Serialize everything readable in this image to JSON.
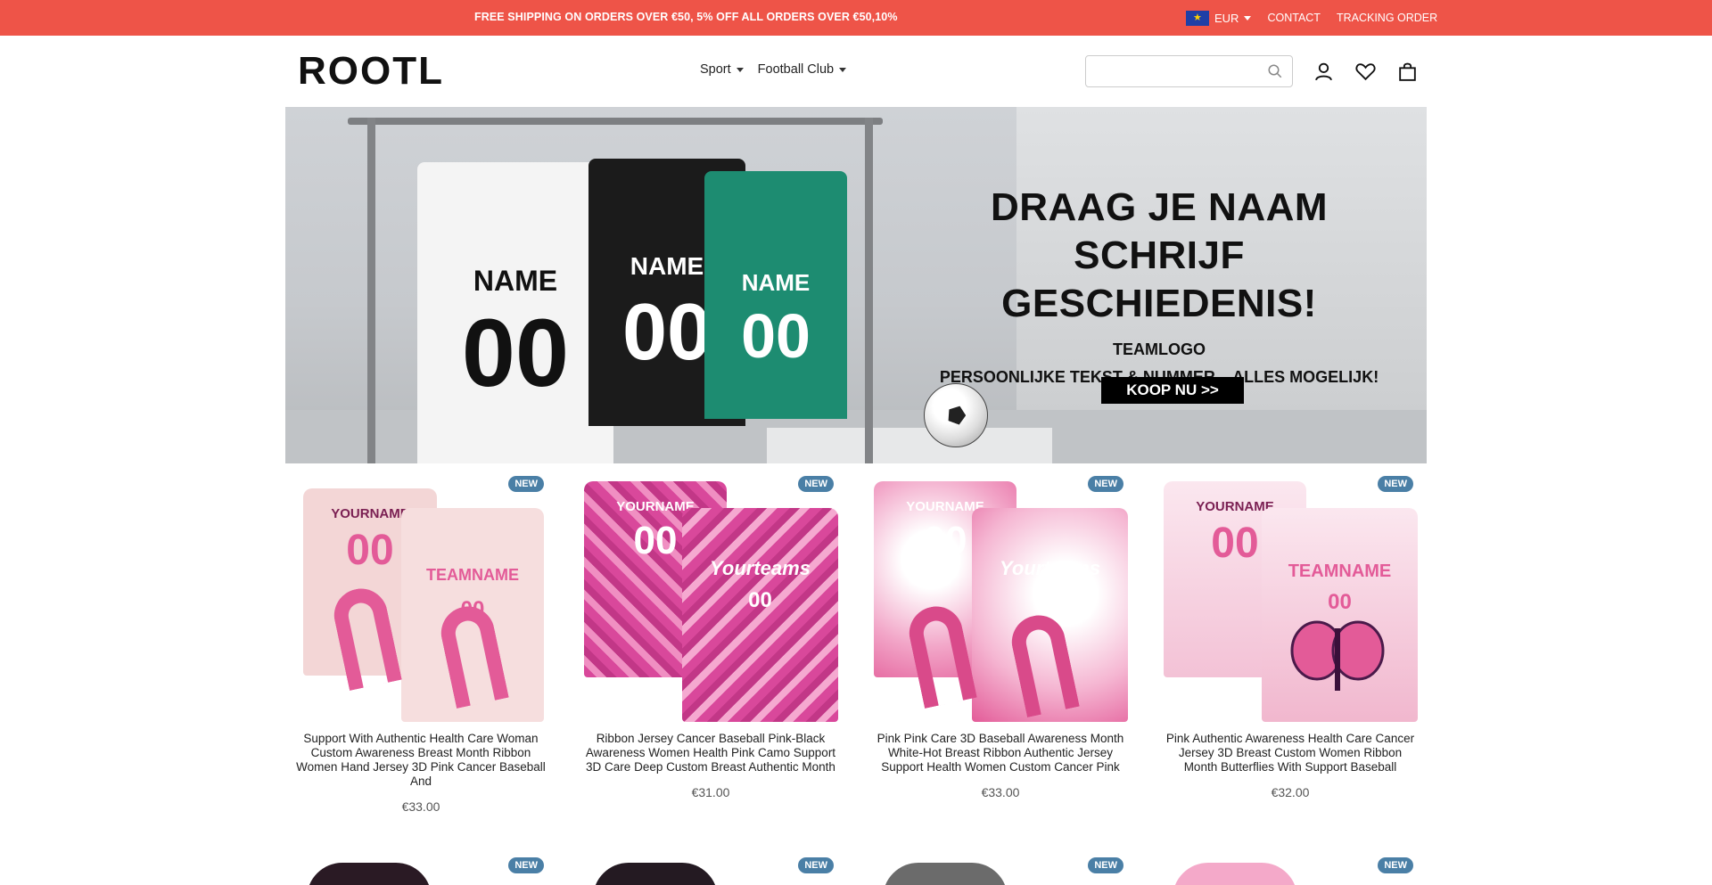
{
  "topbar": {
    "promo": "FREE SHIPPING ON ORDERS OVER €50, 5% OFF ALL ORDERS OVER €50,10%",
    "currency": "EUR",
    "contact": "CONTACT",
    "tracking": "TRACKING ORDER"
  },
  "header": {
    "logo": "ROOTL",
    "nav": [
      {
        "label": "Sport"
      },
      {
        "label": "Football Club"
      }
    ],
    "search": {
      "placeholder": "",
      "value": ""
    }
  },
  "hero": {
    "jerseys": [
      {
        "name": "NAME",
        "number": "00"
      },
      {
        "name": "NAME",
        "number": "00"
      },
      {
        "name": "NAME",
        "number": "00"
      }
    ],
    "headline_line1": "DRAAG JE NAAM",
    "headline_line2": "SCHRIJF GESCHIEDENIS!",
    "sub1": "TEAMLOGO",
    "sub2": "PERSOONLIJKE TEKST & NUMMER – ALLES MOGELIJK!",
    "cta": "KOOP NU >>"
  },
  "products": [
    {
      "badge": "NEW",
      "title": "Support With Authentic Health Care Woman Custom Awareness Breast Month Ribbon Women Hand Jersey 3D Pink Cancer Baseball And",
      "price": "€33.00",
      "shirt_text": [
        "YOURNAME",
        "00",
        "TEAMNAME",
        "00"
      ]
    },
    {
      "badge": "NEW",
      "title": "Ribbon Jersey Cancer Baseball Pink-Black Awareness Women Health Pink Camo Support 3D Care Deep Custom Breast Authentic Month",
      "price": "€31.00",
      "shirt_text": [
        "YOURNAME",
        "00",
        "Yourteams",
        "00"
      ]
    },
    {
      "badge": "NEW",
      "title": "Pink Pink Care 3D Baseball Awareness Month White-Hot Breast Ribbon Authentic Jersey Support Health Women Custom Cancer Pink",
      "price": "€33.00",
      "shirt_text": [
        "YOURNAME",
        "00",
        "Yourteams",
        "00"
      ]
    },
    {
      "badge": "NEW",
      "title": "Pink Authentic Awareness Health Care Cancer Jersey 3D Breast Custom Women Ribbon Month Butterflies With Support Baseball",
      "price": "€32.00",
      "shirt_text": [
        "YOURNAME",
        "00",
        "TEAMNAME",
        "00"
      ]
    }
  ],
  "row2_badges": [
    "NEW",
    "NEW",
    "NEW",
    "NEW"
  ],
  "colors": {
    "topbar": "#ee5448",
    "badge": "#4a7fa6",
    "pink": "#e35b98",
    "cta": "#000000"
  }
}
